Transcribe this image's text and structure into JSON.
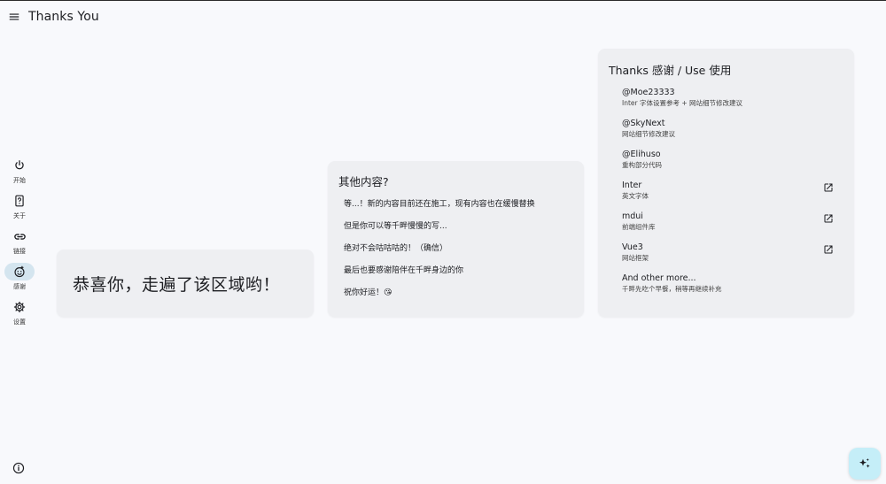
{
  "header": {
    "title": "Thanks You",
    "menu_icon": "menu-icon"
  },
  "rail": {
    "items": [
      {
        "label": "开始",
        "icon": "power-icon",
        "active": false
      },
      {
        "label": "关于",
        "icon": "help-icon",
        "active": false
      },
      {
        "label": "链接",
        "icon": "link-icon",
        "active": false
      },
      {
        "label": "感谢",
        "icon": "emoji-icon",
        "active": true
      },
      {
        "label": "设置",
        "icon": "gear-icon",
        "active": false
      }
    ],
    "active_color": "#d4e5ef"
  },
  "hero": {
    "text": "恭喜你，走遍了该区域哟！"
  },
  "other": {
    "title": "其他内容?",
    "lines": [
      "等...！新的内容目前还在施工，现有内容也在缓慢替换",
      "但是你可以等千畔慢慢的写...",
      "绝对不会咕咕咕的！（确信）",
      "最后也要感谢陪伴在千畔身边的你",
      "祝你好运！😘"
    ]
  },
  "thanks": {
    "title": "Thanks 感谢 / Use 使用",
    "items": [
      {
        "name": "@Moe23333",
        "desc": "Inter 字体设置参考 + 网站细节修改建议"
      },
      {
        "name": "@SkyNext",
        "desc": "网站细节修改建议"
      },
      {
        "name": "@Elihuso",
        "desc": "重构部分代码"
      },
      {
        "name": "Inter",
        "desc": "英文字体"
      },
      {
        "name": "mdui",
        "desc": "前端组件库"
      },
      {
        "name": "Vue3",
        "desc": "网站框架"
      },
      {
        "name": "And other more...",
        "desc": "千畔先吃个早餐，稍等再继续补充"
      }
    ]
  },
  "colors": {
    "background": "#f8f9fc",
    "card": "#eeeff2",
    "fab": "#c5eef8"
  },
  "fab": {
    "icon": "sparkle-icon"
  }
}
